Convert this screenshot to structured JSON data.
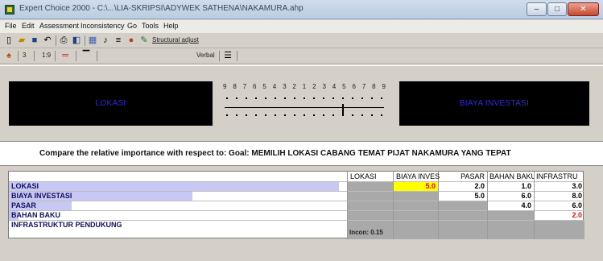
{
  "window": {
    "title": "Expert Choice 2000 - C:\\...\\LIA-SKRIPSI\\ADYWEK SATHENA\\NAKAMURA.ahp",
    "minimize": "–",
    "maximize": "□",
    "close": "✕"
  },
  "menu": [
    "File",
    "Edit",
    "Assessment",
    "Inconsistency",
    "Go",
    "Tools",
    "Help"
  ],
  "toolbar1": {
    "icons": [
      "new-icon",
      "open-icon",
      "save-icon",
      "undo-icon",
      "print-icon",
      "preview-icon",
      "pairwise-icon",
      "verbal-icon",
      "graph-icon",
      "color-icon",
      "wand-icon"
    ],
    "structural_adjust_label": "Structural adjust"
  },
  "toolbar2": {
    "items": [
      "3",
      "1:9",
      "|||"
    ],
    "mode_label": "Verbal"
  },
  "comparison": {
    "left_item": "LOKASI",
    "right_item": "BIAYA INVESTASI",
    "scale": [
      "9",
      "8",
      "7",
      "6",
      "5",
      "4",
      "3",
      "2",
      "1",
      "2",
      "3",
      "4",
      "5",
      "6",
      "7",
      "8",
      "9"
    ],
    "slider_value": 5
  },
  "prompt": "Compare the relative importance  with respect to: Goal: MEMILIH LOKASI CABANG TEMAT PIJAT NAKAMURA YANG TEPAT",
  "matrix": {
    "columns": [
      "LOKASI",
      "BIAYA INVESTASI",
      "PASAR",
      "BAHAN BAKU",
      "INFRASTRU"
    ],
    "rows": [
      {
        "label": "LOKASI",
        "values": [
          "",
          "5.0",
          "2.0",
          "1.0",
          "3.0"
        ]
      },
      {
        "label": "BIAYA INVESTASI",
        "values": [
          "",
          "",
          "5.0",
          "6.0",
          "8.0"
        ]
      },
      {
        "label": "PASAR",
        "values": [
          "",
          "",
          "",
          "4.0",
          "6.0"
        ]
      },
      {
        "label": "BAHAN BAKU",
        "values": [
          "",
          "",
          "",
          "",
          "2.0"
        ]
      },
      {
        "label": "INFRASTRUKTUR PENDUKUNG",
        "values": [
          "",
          "",
          "",
          "",
          ""
        ]
      }
    ],
    "inconsistency": "Incon: 0.15",
    "highlight_color": "#ffff00",
    "inverse_color": "#e01010"
  }
}
